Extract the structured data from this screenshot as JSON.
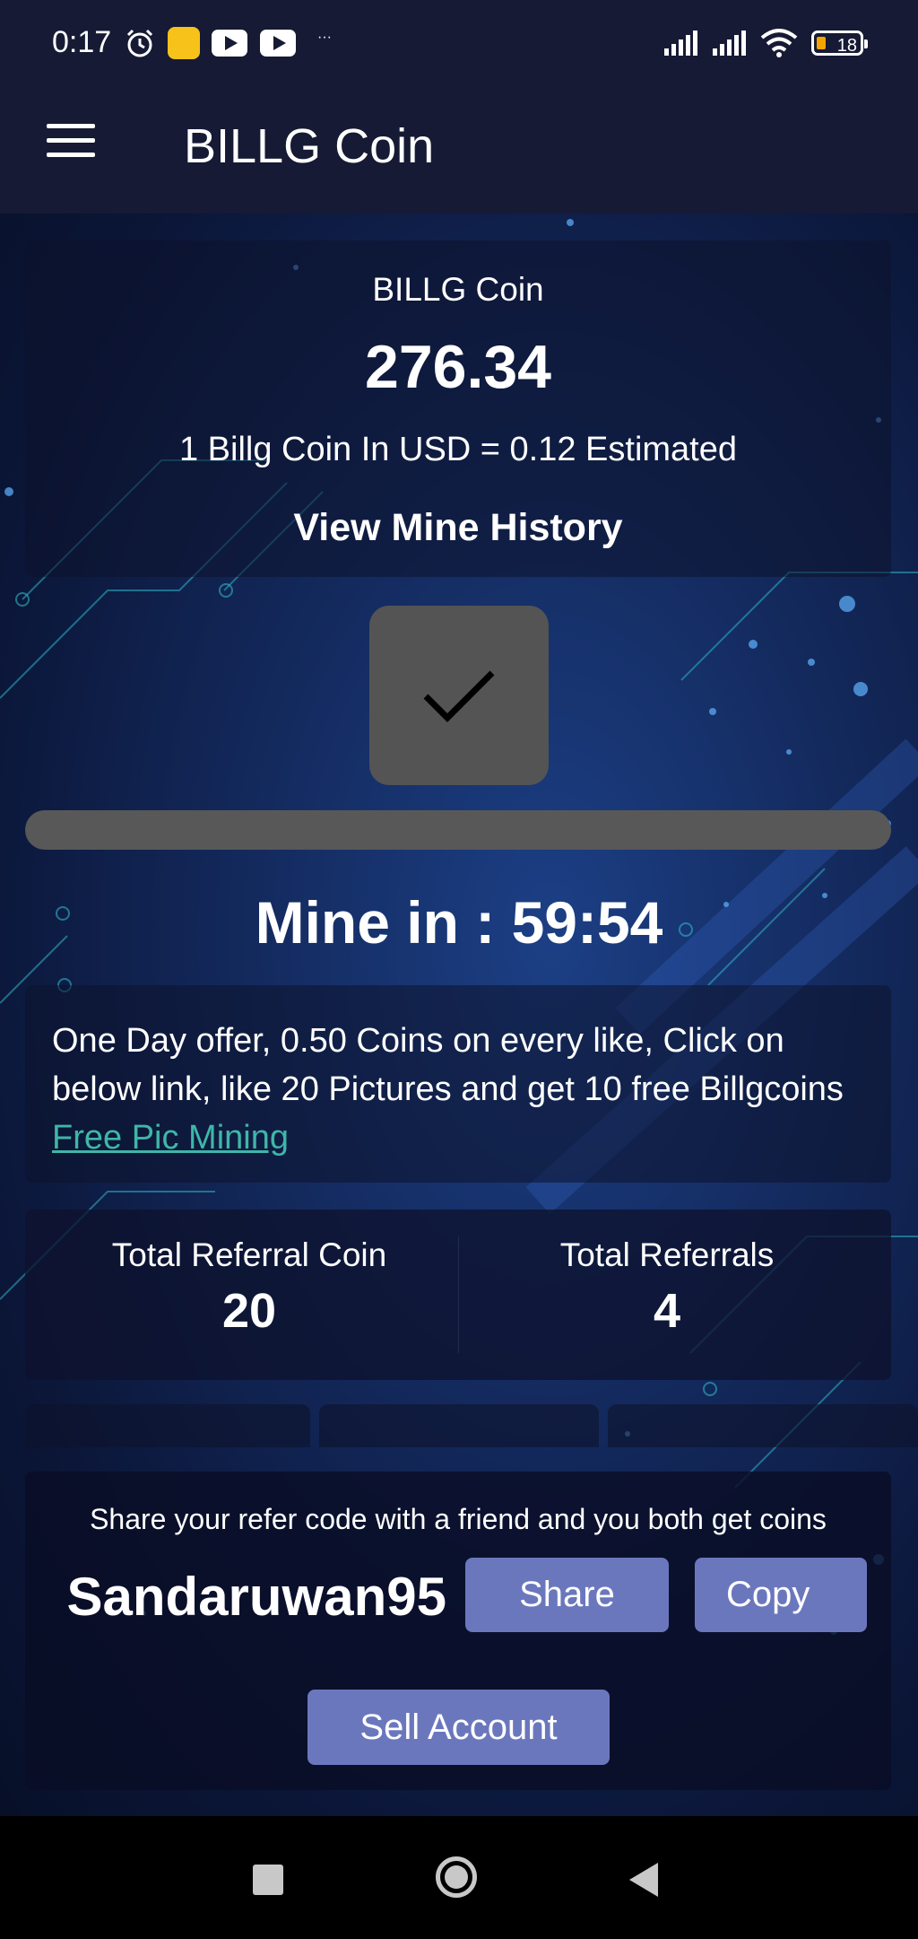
{
  "status_bar": {
    "time": "0:17",
    "more": "···",
    "battery": "18"
  },
  "toolbar": {
    "title": "BILLG Coin",
    "menu_icon": "hamburger-menu-icon"
  },
  "coin_card": {
    "label": "BILLG Coin",
    "balance": "276.34",
    "usd_rate": "1 Billg Coin In USD = 0.12 Estimated",
    "history_link": "View Mine History"
  },
  "mining": {
    "button_icon": "checkmark-icon",
    "timer": "Mine in : 59:54",
    "progress": 0.0
  },
  "offer": {
    "text": "One Day offer, 0.50 Coins on every like, Click on below link, like 20 Pictures and get 10 free Billgcoins ",
    "link": "Free Pic Mining "
  },
  "referrals": {
    "coin_label": "Total Referral Coin",
    "coin_value": "20",
    "count_label": "Total Referrals",
    "count_value": "4"
  },
  "share": {
    "text": "Share your refer code with a friend and you both get coins",
    "refer_code": "Sandaruwan95",
    "share_label": "Share",
    "copy_label": "Copy",
    "sell_label": "Sell Account"
  },
  "colors": {
    "accent_button": "#6b77bd",
    "link": "#3fb6a8",
    "mine_button": "#545454"
  }
}
